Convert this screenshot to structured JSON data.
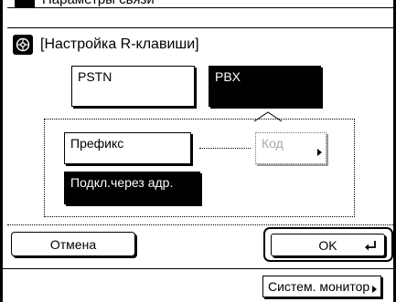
{
  "background_window": {
    "title": "Параметры связи"
  },
  "dialog": {
    "title": "[Настройка R-клавиши]",
    "line_type": {
      "options": [
        "PSTN",
        "PBX"
      ],
      "selected": "PBX"
    },
    "mode": {
      "prefix_label": "Префикс",
      "code_label": "Код",
      "address_label": "Подкл.через адр.",
      "selected": "Подкл.через адр."
    },
    "cancel_label": "Отмена",
    "ok_label": "OK"
  },
  "footer": {
    "monitor_label": "Систем. монитор"
  },
  "colors": {
    "selected_bg": "#000000",
    "selected_fg": "#ffffff",
    "disabled_fg": "#aaaaaa"
  }
}
